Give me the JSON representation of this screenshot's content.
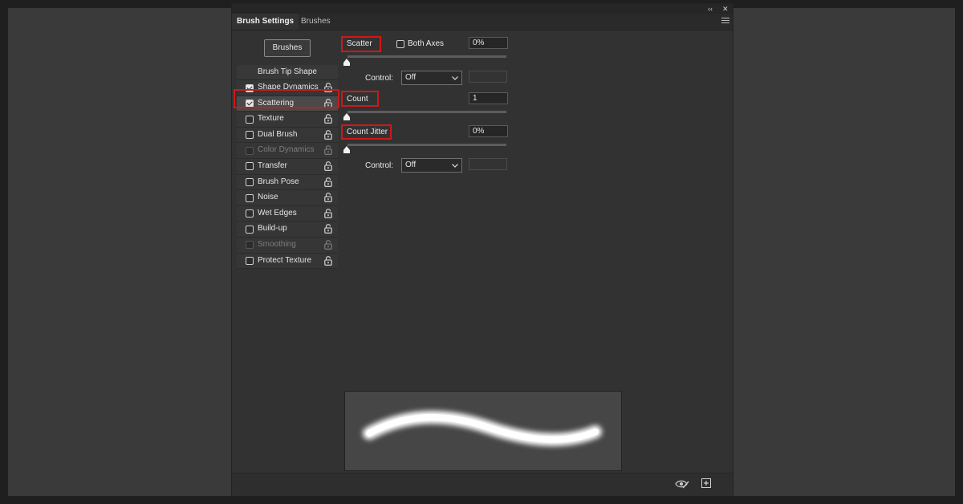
{
  "window": {
    "collapse_glyph": "‹‹",
    "close_glyph": "✕",
    "panel_menu_icon": "panel-menu-icon"
  },
  "tabs": [
    {
      "label": "Brush Settings",
      "active": true
    },
    {
      "label": "Brushes",
      "active": false
    }
  ],
  "brushes_button": "Brushes",
  "list": {
    "header": "Brush Tip Shape",
    "items": [
      {
        "label": "Shape Dynamics",
        "checked": true,
        "enabled": true,
        "selected": false
      },
      {
        "label": "Scattering",
        "checked": true,
        "enabled": true,
        "selected": true
      },
      {
        "label": "Texture",
        "checked": false,
        "enabled": true,
        "selected": false
      },
      {
        "label": "Dual Brush",
        "checked": false,
        "enabled": true,
        "selected": false
      },
      {
        "label": "Color Dynamics",
        "checked": false,
        "enabled": false,
        "selected": false
      },
      {
        "label": "Transfer",
        "checked": false,
        "enabled": true,
        "selected": false
      },
      {
        "label": "Brush Pose",
        "checked": false,
        "enabled": true,
        "selected": false
      },
      {
        "label": "Noise",
        "checked": false,
        "enabled": true,
        "selected": false
      },
      {
        "label": "Wet Edges",
        "checked": false,
        "enabled": true,
        "selected": false
      },
      {
        "label": "Build-up",
        "checked": false,
        "enabled": true,
        "selected": false
      },
      {
        "label": "Smoothing",
        "checked": false,
        "enabled": false,
        "selected": false
      },
      {
        "label": "Protect Texture",
        "checked": false,
        "enabled": true,
        "selected": false
      }
    ]
  },
  "scatter": {
    "label": "Scatter",
    "both_axes_label": "Both Axes",
    "both_axes_checked": false,
    "value": "0%",
    "slider_fraction": 0,
    "control_label": "Control:",
    "control_value": "Off"
  },
  "count": {
    "label": "Count",
    "value": "1",
    "slider_fraction": 0
  },
  "count_jitter": {
    "label": "Count Jitter",
    "value": "0%",
    "slider_fraction": 0,
    "control_label": "Control:",
    "control_value": "Off"
  },
  "highlight_color": "#d01818",
  "footer_icons": [
    "toggle-live-tip-preview-icon",
    "create-new-brush-icon"
  ]
}
